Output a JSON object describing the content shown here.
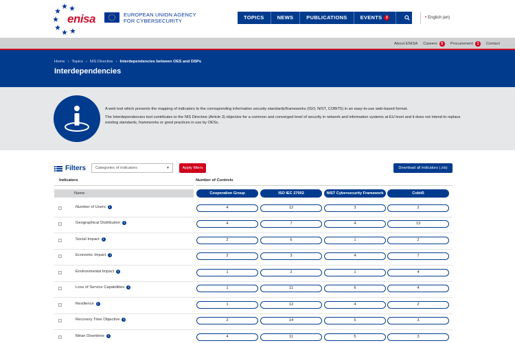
{
  "header": {
    "logo_text": "enisa",
    "agency_line1": "EUROPEAN UNION AGENCY",
    "agency_line2": "FOR CYBERSECURITY",
    "nav": [
      {
        "label": "TOPICS"
      },
      {
        "label": "NEWS"
      },
      {
        "label": "PUBLICATIONS"
      },
      {
        "label": "EVENTS",
        "badge": "3"
      }
    ],
    "language": "English (en)"
  },
  "secondary_nav": [
    {
      "label": "About ENISA"
    },
    {
      "label": "Careers",
      "badge": "5"
    },
    {
      "label": "Procurement",
      "badge": "1"
    },
    {
      "label": "Contact"
    }
  ],
  "breadcrumb": [
    "Home",
    "Topics",
    "NIS Directive",
    "Interdependencies between OES and DSPs"
  ],
  "page_title": "Interdependencies",
  "intro": {
    "p1": "A web tool which presents the mapping of indicators to the corresponding information security standards/frameworks (ISO, NIST, COBIT5) in an easy-to-use web-based format.",
    "p2": "The Interdependencies tool contributes to the NIS Directive (Article 3) objective for a common and converged level of security in network and information systems at EU level and it does not intend to replace existing standards, frameworks or good practices in use by OESs."
  },
  "filters": {
    "label": "Filters",
    "select_placeholder": "Categories of indicators",
    "apply_label": "Apply filters",
    "download_label": "Download all indicators (.xls)"
  },
  "table": {
    "indicators_label": "Indicators",
    "controls_label": "Number of Controls",
    "name_header": "Name",
    "columns": [
      "Cooperation Group",
      "ISO IEC 27002",
      "NIST Cybersecurity Framework",
      "Cobit5"
    ],
    "rows": [
      {
        "name": "Number of Users",
        "values": [
          "4",
          "12",
          "3",
          "2"
        ]
      },
      {
        "name": "Geographical Distribution",
        "values": [
          "4",
          "7",
          "4",
          "13"
        ]
      },
      {
        "name": "Social Impact",
        "values": [
          "2",
          "6",
          "1",
          "2"
        ]
      },
      {
        "name": "Economic Impact",
        "values": [
          "2",
          "3",
          "4",
          "7"
        ]
      },
      {
        "name": "Environmental Impact",
        "values": [
          "1",
          "2",
          "1",
          "4"
        ]
      },
      {
        "name": "Loss of Service Capabilities",
        "values": [
          "1",
          "11",
          "6",
          "4"
        ]
      },
      {
        "name": "Resilience",
        "values": [
          "1",
          "12",
          "4",
          "2"
        ]
      },
      {
        "name": "Recovery Time Objective",
        "values": [
          "2",
          "14",
          "5",
          "3"
        ]
      },
      {
        "name": "Mean Downtime",
        "values": [
          "4",
          "11",
          "5",
          "3"
        ]
      }
    ]
  },
  "colors": {
    "primary": "#003b8e",
    "accent": "#d0021b",
    "grey": "#e6e7e9"
  }
}
